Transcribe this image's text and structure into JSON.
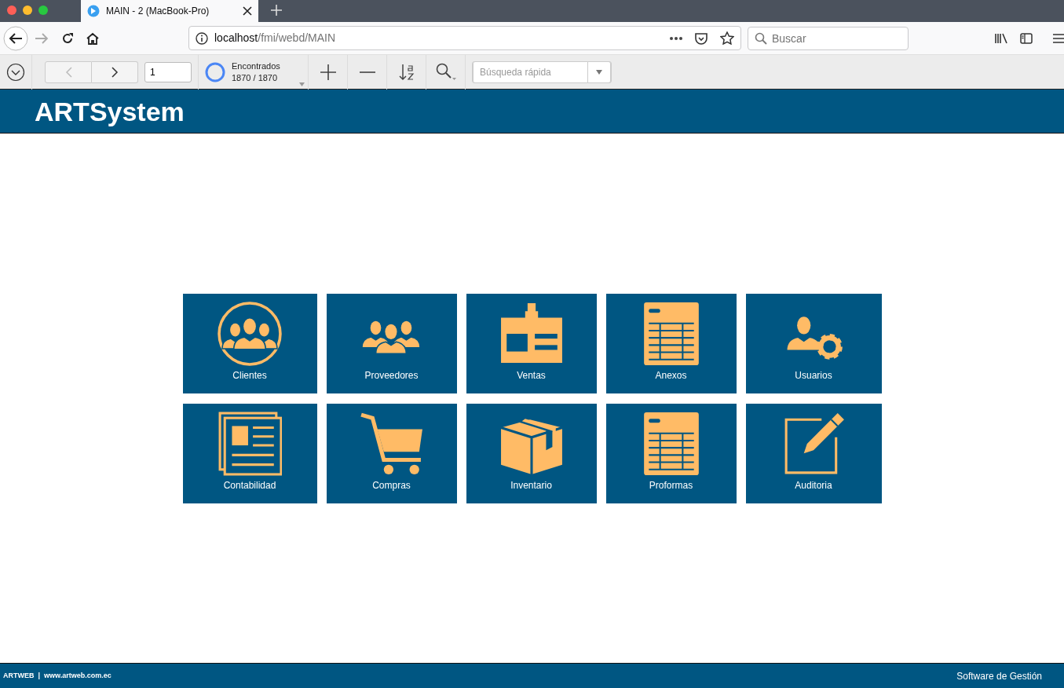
{
  "browser": {
    "tab_title": "MAIN - 2 (MacBook-Pro)",
    "url_host": "localhost",
    "url_path": "/fmi/webd/MAIN",
    "search_placeholder": "Buscar"
  },
  "toolbar": {
    "record": "1",
    "found_label": "Encontrados",
    "found_count": "1870 / 1870",
    "quick_search_placeholder": "Búsqueda rápida"
  },
  "app_title": "ARTSystem",
  "tiles": [
    {
      "label": "Clientes",
      "kind": "people-circle"
    },
    {
      "label": "Proveedores",
      "kind": "people"
    },
    {
      "label": "Ventas",
      "kind": "id-card"
    },
    {
      "label": "Anexos",
      "kind": "sheet"
    },
    {
      "label": "Usuarios",
      "kind": "user-gear"
    },
    {
      "label": "Contabilidad",
      "kind": "pages"
    },
    {
      "label": "Compras",
      "kind": "cart"
    },
    {
      "label": "Inventario",
      "kind": "box"
    },
    {
      "label": "Proformas",
      "kind": "sheet"
    },
    {
      "label": "Auditoria",
      "kind": "edit"
    }
  ],
  "footer": {
    "left": "ARTWEB  |  www.artweb.com.ec",
    "right": "Software de Gestión"
  }
}
